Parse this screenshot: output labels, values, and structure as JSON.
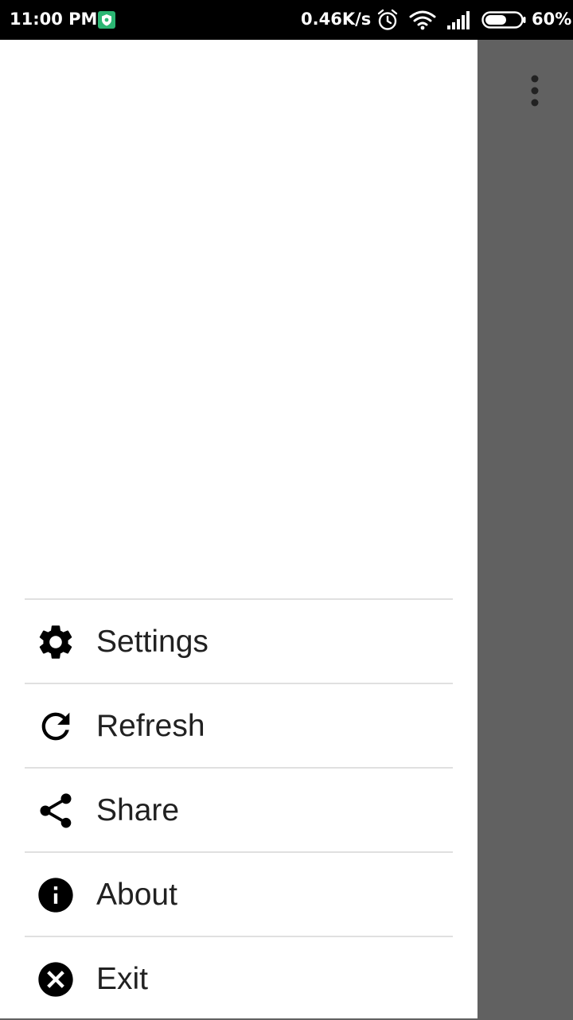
{
  "status_bar": {
    "time": "11:00 PM",
    "net_speed": "0.46K/s",
    "battery_percent": "60%",
    "battery_level": 0.6,
    "icons": [
      "shield-icon",
      "alarm-icon",
      "wifi-icon",
      "signal-icon",
      "battery-icon"
    ],
    "notification_color": "#2bb673"
  },
  "toolbar": {
    "overflow_icon": "more-vert-icon"
  },
  "drawer": {
    "items": [
      {
        "label": "Settings",
        "icon": "gear-icon"
      },
      {
        "label": "Refresh",
        "icon": "refresh-icon"
      },
      {
        "label": "Share",
        "icon": "share-icon"
      },
      {
        "label": "About",
        "icon": "info-icon"
      },
      {
        "label": "Exit",
        "icon": "close-circle-icon"
      }
    ]
  },
  "colors": {
    "scrim": "#616161",
    "drawer_bg": "#ffffff",
    "divider": "#e0e0e0",
    "text": "#212121"
  }
}
